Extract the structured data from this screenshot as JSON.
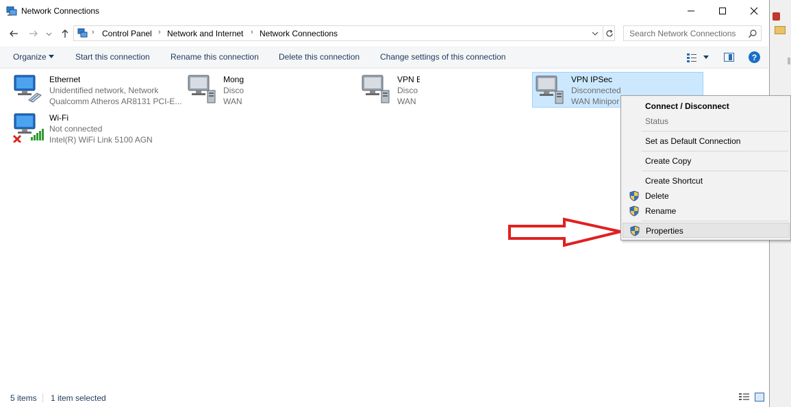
{
  "window": {
    "title": "Network Connections"
  },
  "address": {
    "crumbs": [
      "Control Panel",
      "Network and Internet",
      "Network Connections"
    ],
    "search_placeholder": "Search Network Connections"
  },
  "toolbar": {
    "organize": "Organize",
    "start": "Start this connection",
    "rename": "Rename this connection",
    "delete": "Delete this connection",
    "change": "Change settings of this connection",
    "help": "?"
  },
  "connections": [
    {
      "name": "Ethernet",
      "line2": "Unidentified network, Network",
      "line3": "Qualcomm Atheros AR8131 PCI-E..."
    },
    {
      "name": "Mong",
      "line2": "Disco",
      "line3": "WAN"
    },
    {
      "name": "VPN E",
      "line2": "Disco",
      "line3": "WAN"
    },
    {
      "name": "VPN IPSec",
      "line2": "Disconnected",
      "line3": "WAN Minipor"
    },
    {
      "name": "Wi-Fi",
      "line2": "Not connected",
      "line3": "Intel(R) WiFi Link 5100 AGN"
    }
  ],
  "context_menu": {
    "items": [
      {
        "label": "Connect / Disconnect",
        "bold": true
      },
      {
        "label": "Status",
        "disabled": true
      },
      {
        "label": "Set as Default Connection"
      },
      {
        "label": "Create Copy"
      },
      {
        "label": "Create Shortcut"
      },
      {
        "label": "Delete",
        "shield": true
      },
      {
        "label": "Rename",
        "shield": true
      },
      {
        "label": "Properties",
        "shield": true,
        "highlighted": true
      }
    ]
  },
  "status": {
    "count": "5 items",
    "selected": "1 item selected"
  },
  "colors": {
    "selection": "#cce8ff",
    "arrow": "#e02020",
    "link": "#1e395b"
  }
}
